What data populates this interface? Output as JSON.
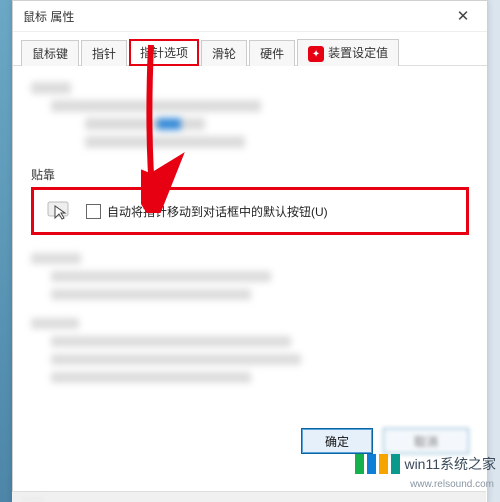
{
  "window": {
    "title": "鼠标 属性"
  },
  "tabs": [
    {
      "id": "buttons",
      "label": "鼠标键"
    },
    {
      "id": "pointers",
      "label": "指针"
    },
    {
      "id": "pointer-options",
      "label": "指针选项",
      "active": true,
      "highlighted": true
    },
    {
      "id": "wheel",
      "label": "滑轮"
    },
    {
      "id": "hardware",
      "label": "硬件"
    },
    {
      "id": "device-settings",
      "label": "装置设定值",
      "has_icon": true
    }
  ],
  "sections": {
    "snap_to": {
      "title": "贴靠",
      "checkbox_label": "自动将指针移动到对话框中的默认按钮(U)",
      "checked": false
    }
  },
  "buttons": {
    "ok": "确定",
    "cancel": "取消"
  },
  "annotation": {
    "highlight_tab": "指针选项",
    "highlight_group": "贴靠",
    "arrow_color": "#e60012"
  },
  "watermark": {
    "brand": "win11系统之家",
    "url": "www.relsound.com"
  }
}
